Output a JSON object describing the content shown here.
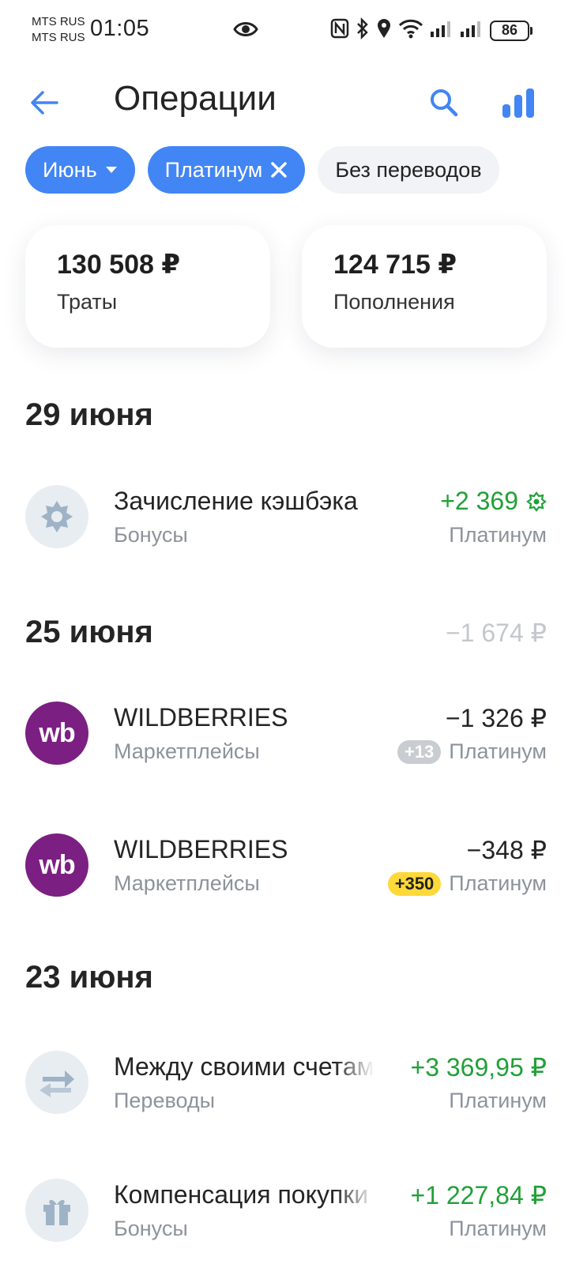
{
  "status_bar": {
    "carrier1": "MTS RUS",
    "carrier2": "MTS RUS",
    "time": "01:05",
    "battery": "86"
  },
  "header": {
    "title": "Операции",
    "back_icon": "arrow-left-icon",
    "search_icon": "search-icon",
    "stats_icon": "bar-chart-icon"
  },
  "filters": {
    "month": "Июнь",
    "card": "Платинум",
    "transfers": "Без переводов"
  },
  "summary": {
    "spending_amount": "130 508 ₽",
    "spending_label": "Траты",
    "income_amount": "124 715 ₽",
    "income_label": "Пополнения"
  },
  "days": [
    {
      "title": "29 июня",
      "total": "",
      "operations": [
        {
          "title": "Зачисление кэшбэка",
          "category": "Бонусы",
          "amount": "+2 369",
          "account": "Платинум",
          "badge": ""
        }
      ]
    },
    {
      "title": "25 июня",
      "total": "−1 674 ₽",
      "operations": [
        {
          "title": "WILDBERRIES",
          "category": "Маркетплейсы",
          "amount": "−1 326 ₽",
          "account": "Платинум",
          "badge": "+13"
        },
        {
          "title": "WILDBERRIES",
          "category": "Маркетплейсы",
          "amount": "−348 ₽",
          "account": "Платинум",
          "badge": "+350"
        }
      ]
    },
    {
      "title": "23 июня",
      "total": "",
      "operations": [
        {
          "title": "Между своими счетами",
          "category": "Переводы",
          "amount": "+3 369,95 ₽",
          "account": "Платинум",
          "badge": ""
        },
        {
          "title": "Компенсация покупки",
          "category": "Бонусы",
          "amount": "+1 227,84 ₽",
          "account": "Платинум",
          "badge": ""
        }
      ]
    }
  ],
  "wb_logo_text": "wb",
  "colors": {
    "accent": "#4285f4",
    "positive": "#21a038",
    "wb_brand": "#7b1f83",
    "badge_yellow": "#ffd83a"
  }
}
